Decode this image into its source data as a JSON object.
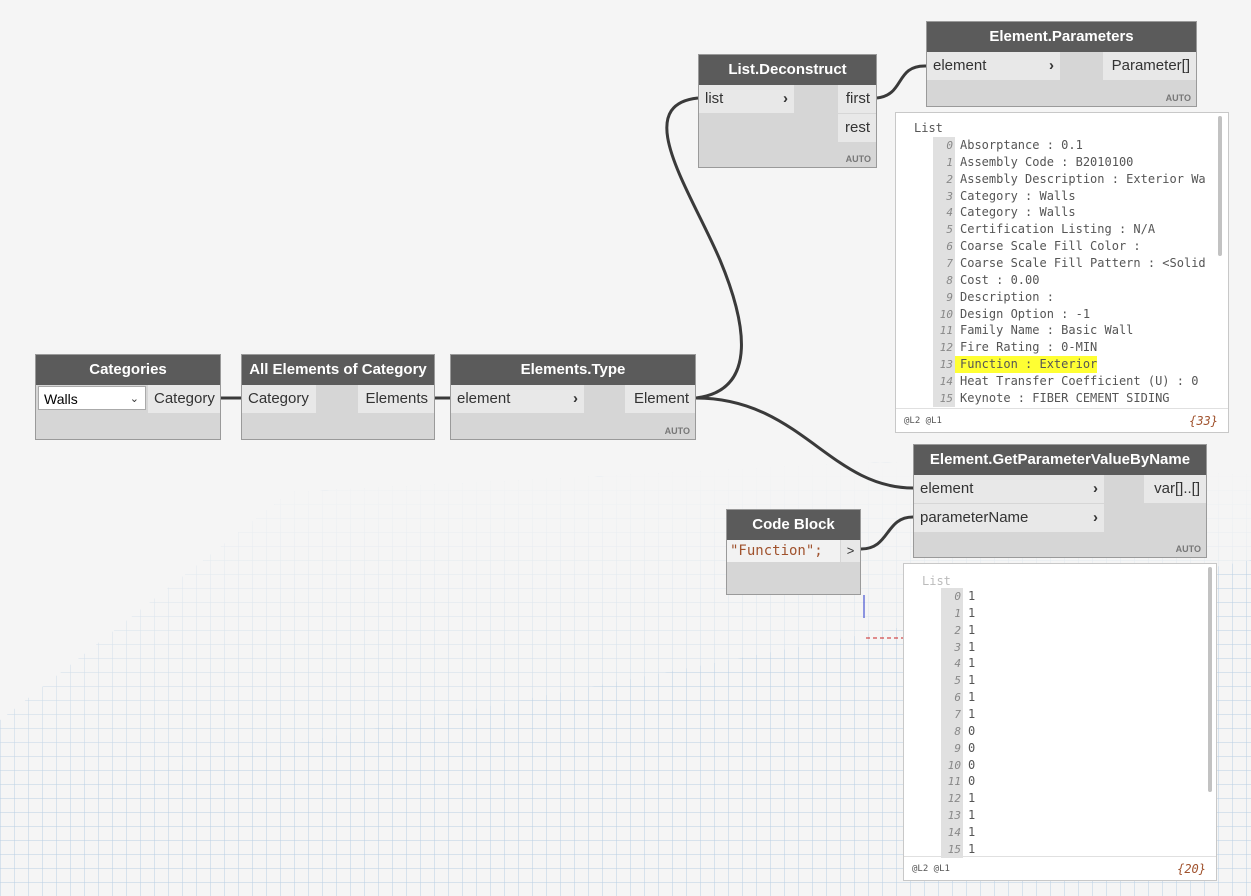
{
  "nodes": {
    "categories": {
      "title": "Categories",
      "dropdown_value": "Walls",
      "out_port": "Category"
    },
    "all_elements": {
      "title": "All Elements of Category",
      "in_port": "Category",
      "out_port": "Elements"
    },
    "elements_type": {
      "title": "Elements.Type",
      "in_port": "element",
      "out_port": "Element",
      "lacing": "AUTO"
    },
    "list_deconstruct": {
      "title": "List.Deconstruct",
      "in_port": "list",
      "out_first": "first",
      "out_rest": "rest",
      "lacing": "AUTO"
    },
    "element_parameters": {
      "title": "Element.Parameters",
      "in_port": "element",
      "out_port": "Parameter[]",
      "lacing": "AUTO"
    },
    "get_param": {
      "title": "Element.GetParameterValueByName",
      "in_element": "element",
      "in_param": "parameterName",
      "out_port": "var[]..[]",
      "lacing": "AUTO"
    },
    "code_block": {
      "title": "Code Block",
      "code": "\"Function\";",
      "out_port": ">"
    }
  },
  "watch_parameters": {
    "title": "List",
    "items": [
      {
        "i": "0",
        "text": "Absorptance : 0.1"
      },
      {
        "i": "1",
        "text": "Assembly Code : B2010100"
      },
      {
        "i": "2",
        "text": "Assembly Description : Exterior Wa"
      },
      {
        "i": "3",
        "text": "Category : Walls"
      },
      {
        "i": "4",
        "text": "Category : Walls"
      },
      {
        "i": "5",
        "text": "Certification Listing : N/A"
      },
      {
        "i": "6",
        "text": "Coarse Scale Fill Color :"
      },
      {
        "i": "7",
        "text": "Coarse Scale Fill Pattern : <Solid"
      },
      {
        "i": "8",
        "text": "Cost : 0.00"
      },
      {
        "i": "9",
        "text": "Description :"
      },
      {
        "i": "10",
        "text": "Design Option : -1"
      },
      {
        "i": "11",
        "text": "Family Name : Basic Wall"
      },
      {
        "i": "12",
        "text": "Fire Rating : 0-MIN"
      },
      {
        "i": "13",
        "text": "Function : Exterior"
      },
      {
        "i": "14",
        "text": "Heat Transfer Coefficient (U) : 0"
      },
      {
        "i": "15",
        "text": "Keynote : FIBER CEMENT SIDING"
      }
    ],
    "levels": "@L2 @L1",
    "count": "{33}"
  },
  "watch_values": {
    "title": "List",
    "items": [
      {
        "i": "0",
        "text": "1"
      },
      {
        "i": "1",
        "text": "1"
      },
      {
        "i": "2",
        "text": "1"
      },
      {
        "i": "3",
        "text": "1"
      },
      {
        "i": "4",
        "text": "1"
      },
      {
        "i": "5",
        "text": "1"
      },
      {
        "i": "6",
        "text": "1"
      },
      {
        "i": "7",
        "text": "1"
      },
      {
        "i": "8",
        "text": "0"
      },
      {
        "i": "9",
        "text": "0"
      },
      {
        "i": "10",
        "text": "0"
      },
      {
        "i": "11",
        "text": "0"
      },
      {
        "i": "12",
        "text": "1"
      },
      {
        "i": "13",
        "text": "1"
      },
      {
        "i": "14",
        "text": "1"
      },
      {
        "i": "15",
        "text": "1"
      }
    ],
    "levels": "@L2 @L1",
    "count": "{20}"
  },
  "colors": {
    "node_header": "#5b5b5b",
    "node_body": "#d6d6d6",
    "wire": "#3a3a3a",
    "highlight": "#ffff33",
    "annotation": "#e01b1b"
  }
}
